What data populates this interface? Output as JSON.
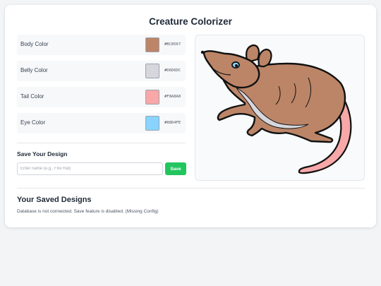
{
  "title": "Creature Colorizer",
  "colors": [
    {
      "label": "Body Color",
      "hex": "#BC8567",
      "swatch": "#BC8567"
    },
    {
      "label": "Belly Color",
      "hex": "#D6D6DC",
      "swatch": "#D6D6DC"
    },
    {
      "label": "Tail Color",
      "hex": "#F8A8A8",
      "swatch": "#F8A8A8"
    },
    {
      "label": "Eye Color",
      "hex": "#88D4FE",
      "swatch": "#88D4FE"
    }
  ],
  "save": {
    "heading": "Save Your Design",
    "placeholder": "Enter name (e.g., Fire Rat)",
    "button_label": "Save",
    "button_color": "#22C55E"
  },
  "saved": {
    "heading": "Your Saved Designs",
    "message": "Database is not connected. Save feature is disabled. (Missing Config)"
  }
}
